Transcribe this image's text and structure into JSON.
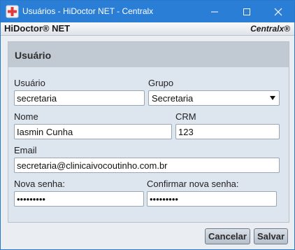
{
  "window": {
    "title": "Usuários - HiDoctor NET - Centralx",
    "controls": {
      "minimize": "minimize-icon",
      "maximize": "maximize-icon",
      "close": "close-icon"
    },
    "accent": "#2b7ed6"
  },
  "brandbar": {
    "left": "HiDoctor® NET",
    "right": "Centralx®"
  },
  "panel": {
    "title": "Usuário"
  },
  "form": {
    "usuario": {
      "label": "Usuário",
      "value": "secretaria"
    },
    "grupo": {
      "label": "Grupo",
      "value": "Secretaria"
    },
    "nome": {
      "label": "Nome",
      "value": "Iasmin Cunha"
    },
    "crm": {
      "label": "CRM",
      "value": "123"
    },
    "email": {
      "label": "Email",
      "value": "secretaria@clinicaivocoutinho.com.br"
    },
    "nova_senha": {
      "label": "Nova senha:",
      "value": "•••••••••"
    },
    "confirmar_senha": {
      "label": "Confirmar nova senha:",
      "value": "•••••••••"
    }
  },
  "buttons": {
    "cancel": "Cancelar",
    "save": "Salvar"
  }
}
